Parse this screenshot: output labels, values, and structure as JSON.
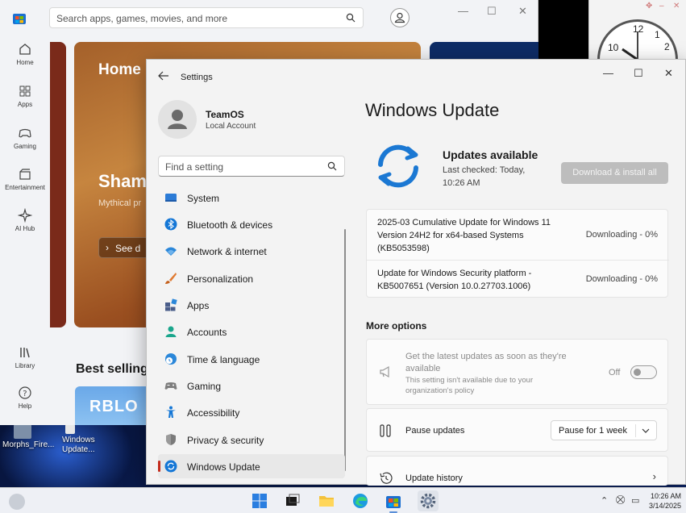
{
  "desktop": {
    "icons": [
      {
        "label_1": "Morphs_Fire..."
      },
      {
        "label_1": "Windows",
        "label_2": "Update..."
      }
    ]
  },
  "clock": {
    "numbers": [
      "12",
      "10",
      "1",
      "2"
    ]
  },
  "store": {
    "search_placeholder": "Search apps, games, movies, and more",
    "nav": [
      {
        "label": "Home",
        "icon": "home-icon"
      },
      {
        "label": "Apps",
        "icon": "apps-icon"
      },
      {
        "label": "Gaming",
        "icon": "gaming-icon"
      },
      {
        "label": "Entertainment",
        "icon": "entertainment-icon"
      },
      {
        "label": "AI Hub",
        "icon": "ai-hub-icon"
      },
      {
        "label": "Library",
        "icon": "library-icon"
      },
      {
        "label": "Help",
        "icon": "help-icon"
      }
    ],
    "hero_title": "Home",
    "hero_heading": "Sham",
    "hero_sub": "Mythical pr",
    "hero_button": "See d",
    "best_selling": "Best selling",
    "roblox_text": "RBLO"
  },
  "settings": {
    "window_title": "Settings",
    "profile": {
      "name": "TeamOS",
      "type": "Local Account"
    },
    "find_placeholder": "Find a setting",
    "nav": [
      {
        "label": "System",
        "icon": "system-icon",
        "color": "#2b7bd6"
      },
      {
        "label": "Bluetooth & devices",
        "icon": "bluetooth-icon",
        "color": "#1577d6"
      },
      {
        "label": "Network & internet",
        "icon": "wifi-icon",
        "color": "#2b87d9"
      },
      {
        "label": "Personalization",
        "icon": "brush-icon",
        "color": "#e07a32"
      },
      {
        "label": "Apps",
        "icon": "apps-icon",
        "color": "#4a5d8a"
      },
      {
        "label": "Accounts",
        "icon": "accounts-icon",
        "color": "#1aa68c"
      },
      {
        "label": "Time & language",
        "icon": "globe-clock-icon",
        "color": "#2b87d9"
      },
      {
        "label": "Gaming",
        "icon": "controller-icon",
        "color": "#7d7d7d"
      },
      {
        "label": "Accessibility",
        "icon": "accessibility-icon",
        "color": "#1577d6"
      },
      {
        "label": "Privacy & security",
        "icon": "shield-icon",
        "color": "#7a7a7a"
      },
      {
        "label": "Windows Update",
        "icon": "windows-update-icon",
        "color": "#1577d6"
      }
    ],
    "selected_nav": "Windows Update",
    "content": {
      "title": "Windows Update",
      "status": "Updates available",
      "last_checked": "Last checked: Today, 10:26 AM",
      "download_button": "Download & install all",
      "updates": [
        {
          "line_1": "2025-03 Cumulative Update for Windows 11",
          "line_2": "Version 24H2 for x64-based Systems",
          "line_3": "(KB5053598)",
          "status": "Downloading - 0%"
        },
        {
          "line_1": "Update for Windows Security platform -",
          "line_2": "KB5007651 (Version 10.0.27703.1006)",
          "status": "Downloading - 0%"
        }
      ],
      "more_options": "More options",
      "latest_updates": {
        "title": "Get the latest updates as soon as they're available",
        "note": "This setting isn't available due to your organization's policy",
        "toggle_label": "Off"
      },
      "pause_updates": {
        "title": "Pause updates",
        "value": "Pause for 1 week"
      },
      "update_history": {
        "title": "Update history"
      }
    }
  },
  "taskbar": {
    "time": "10:26 AM",
    "date": "3/14/2025"
  },
  "colors": {
    "accent": "#1577d6",
    "selected_indicator": "#c42b1c"
  }
}
